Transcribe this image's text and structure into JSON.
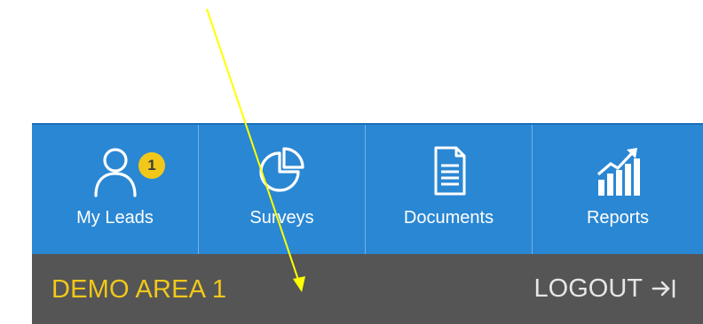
{
  "nav": {
    "items": [
      {
        "label": "My Leads",
        "icon": "person-icon",
        "badge": "1"
      },
      {
        "label": "Surveys",
        "icon": "pie-chart-icon"
      },
      {
        "label": "Documents",
        "icon": "document-icon"
      },
      {
        "label": "Reports",
        "icon": "bar-chart-trend-icon"
      }
    ]
  },
  "footer": {
    "area": "DEMO AREA 1",
    "logout_label": "LOGOUT",
    "logout_icon": "logout-arrow-icon"
  },
  "colors": {
    "nav_background": "#2a87d3",
    "footer_background": "#555555",
    "accent_yellow": "#f1c81a",
    "annotation_arrow": "#ffff00"
  }
}
